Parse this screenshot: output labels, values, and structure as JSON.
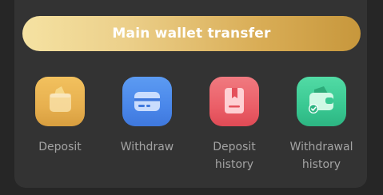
{
  "wallet": {
    "transfer_label": "Main wallet transfer"
  },
  "actions": [
    {
      "icon": "wallet-deposit-icon",
      "label": "Deposit",
      "color": "#e7b04f"
    },
    {
      "icon": "card-withdraw-icon",
      "label": "Withdraw",
      "color": "#4a87ea"
    },
    {
      "icon": "bookmark-history-icon",
      "label": "Deposit\nhistory",
      "color": "#eb5f68"
    },
    {
      "icon": "wallet-check-icon",
      "label": "Withdrawal\nhistory",
      "color": "#39c892"
    }
  ],
  "colors": {
    "background": "#262626",
    "panel": "#333333",
    "label_text": "#a3a3a3",
    "transfer_gradient": [
      "#f5e2a2",
      "#c7973c"
    ]
  }
}
